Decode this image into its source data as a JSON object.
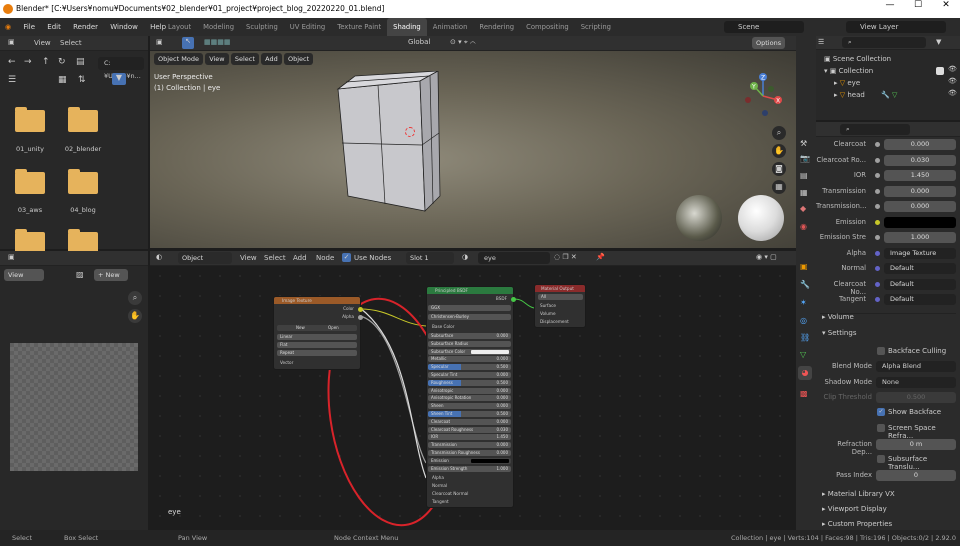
{
  "window": {
    "title": "Blender* [C:¥Users¥nomu¥Documents¥02_blender¥01_project¥project_blog_20220220_01.blend]",
    "min": "—",
    "max": "☐",
    "close": "✕"
  },
  "menu": [
    "File",
    "Edit",
    "Render",
    "Window",
    "Help"
  ],
  "workspaces": [
    "Layout",
    "Modeling",
    "Sculpting",
    "UV Editing",
    "Texture Paint",
    "Shading",
    "Animation",
    "Rendering",
    "Compositing",
    "Scripting"
  ],
  "workspace_active": "Shading",
  "scene": {
    "label": "Scene",
    "view_layer": "View Layer"
  },
  "filebrowser": {
    "view": "View",
    "select": "Select",
    "path": "C:¥Users¥n...",
    "folders": [
      "01_unity",
      "02_blender",
      "03_aws",
      "04_blog",
      "",
      ""
    ]
  },
  "viewport": {
    "mode": "Object Mode",
    "view": "View",
    "select": "Select",
    "add": "Add",
    "object": "Object",
    "info1": "User Perspective",
    "info2": "(1) Collection | eye",
    "orientation": "Global",
    "options": "Options",
    "axes": {
      "x": "X",
      "y": "Y",
      "z": "Z"
    }
  },
  "image_editor": {
    "view": "View",
    "new": "+ New"
  },
  "node_editor": {
    "object": "Object",
    "view": "View",
    "select": "Select",
    "add": "Add",
    "node": "Node",
    "use_nodes": "Use Nodes",
    "slot": "Slot 1",
    "material": "eye",
    "object_label": "eye"
  },
  "nodes": {
    "image_texture": {
      "title": "Image Texture",
      "out_color": "Color",
      "out_alpha": "Alpha",
      "new": "New",
      "open": "Open",
      "interp": "Linear",
      "proj": "Flat",
      "ext": "Repeat",
      "vector": "Vector"
    },
    "bsdf": {
      "title": "Principled BSDF",
      "out": "BSDF",
      "dist": "GGX",
      "sss": "Christensen-Burley",
      "base": "Base Color",
      "rows": [
        [
          "Subsurface",
          "0.000"
        ],
        [
          "Subsurface Radius",
          ""
        ],
        [
          "Subsurface Color",
          ""
        ],
        [
          "Metallic",
          "0.000"
        ],
        [
          "Specular",
          "0.500"
        ],
        [
          "Specular Tint",
          "0.000"
        ],
        [
          "Roughness",
          "0.500"
        ],
        [
          "Anisotropic",
          "0.000"
        ],
        [
          "Anisotropic Rotation",
          "0.000"
        ],
        [
          "Sheen",
          "0.000"
        ],
        [
          "Sheen Tint",
          "0.500"
        ],
        [
          "Clearcoat",
          "0.000"
        ],
        [
          "Clearcoat Roughness",
          "0.030"
        ],
        [
          "IOR",
          "1.450"
        ],
        [
          "Transmission",
          "0.000"
        ],
        [
          "Transmission Roughness",
          "0.000"
        ],
        [
          "Emission",
          ""
        ],
        [
          "Emission Strength",
          "1.000"
        ]
      ],
      "tail": [
        "Alpha",
        "Normal",
        "Clearcoat Normal",
        "Tangent"
      ]
    },
    "output": {
      "title": "Material Output",
      "target": "All",
      "inputs": [
        "Surface",
        "Volume",
        "Displacement"
      ]
    }
  },
  "outliner": {
    "scene_collection": "Scene Collection",
    "collection": "Collection",
    "items": [
      "eye",
      "head"
    ]
  },
  "properties": {
    "rows": [
      [
        "Clearcoat",
        "0.000"
      ],
      [
        "Clearcoat Ro...",
        "0.030"
      ],
      [
        "IOR",
        "1.450"
      ],
      [
        "Transmission",
        "0.000"
      ],
      [
        "Transmission...",
        "0.000"
      ],
      [
        "Emission",
        ""
      ],
      [
        "Emission Stre",
        "1.000"
      ],
      [
        "Alpha",
        "Image Texture"
      ],
      [
        "Normal",
        "Default"
      ],
      [
        "Clearcoat No...",
        "Default"
      ],
      [
        "Tangent",
        "Default"
      ]
    ],
    "volume": "Volume",
    "settings": "Settings",
    "backface": "Backface Culling",
    "blend_label": "Blend Mode",
    "blend": "Alpha Blend",
    "shadow_label": "Shadow Mode",
    "shadow": "None",
    "clip_label": "Clip Threshold",
    "clip": "0.500",
    "show_backface": "Show Backface",
    "ssr": "Screen Space Refra...",
    "refr_label": "Refraction Dep...",
    "refr": "0 m",
    "sss_trans": "Subsurface Translu...",
    "pass_label": "Pass Index",
    "pass": "0",
    "sections": [
      "Material Library VX",
      "Viewport Display",
      "Custom Properties"
    ]
  },
  "status": {
    "select": "Select",
    "box": "Box Select",
    "pan": "Pan View",
    "context": "Node Context Menu",
    "right": "Collection | eye | Verts:104 | Faces:98 | Tris:196 | Objects:0/2 | 2.92.0"
  }
}
